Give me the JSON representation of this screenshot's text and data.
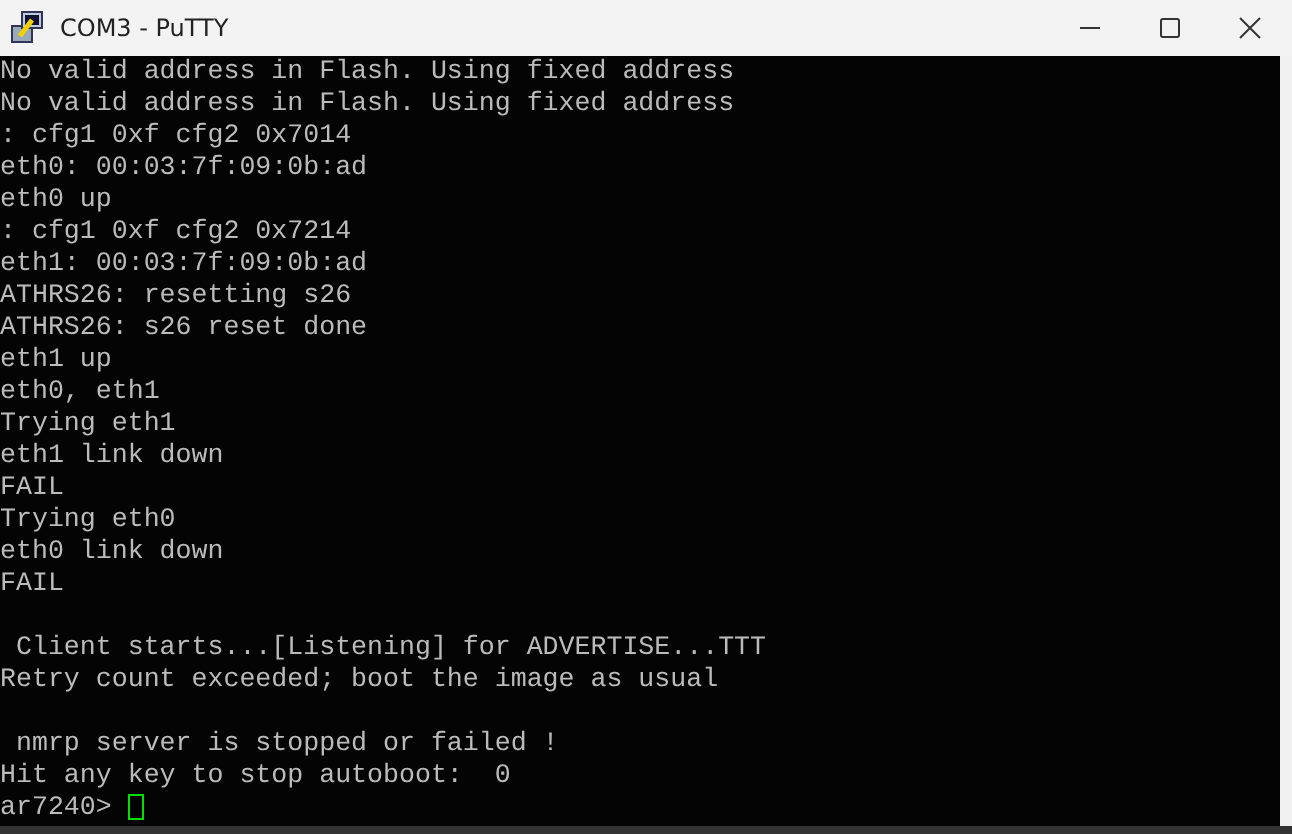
{
  "window": {
    "title": "COM3 - PuTTY"
  },
  "terminal": {
    "blocks": [
      [
        "No valid address in Flash. Using fixed address",
        "No valid address in Flash. Using fixed address",
        ": cfg1 0xf cfg2 0x7014",
        "eth0: 00:03:7f:09:0b:ad",
        "eth0 up",
        ": cfg1 0xf cfg2 0x7214",
        "eth1: 00:03:7f:09:0b:ad",
        "ATHRS26: resetting s26",
        "ATHRS26: s26 reset done",
        "eth1 up",
        "eth0, eth1",
        "Trying eth1",
        "eth1 link down",
        "FAIL",
        "Trying eth0",
        "eth0 link down",
        "FAIL"
      ],
      [
        " Client starts...[Listening] for ADVERTISE...TTT",
        "Retry count exceeded; boot the image as usual"
      ],
      [
        " nmrp server is stopped or failed !",
        "Hit any key to stop autoboot:  0"
      ]
    ],
    "prompt": "ar7240> "
  }
}
